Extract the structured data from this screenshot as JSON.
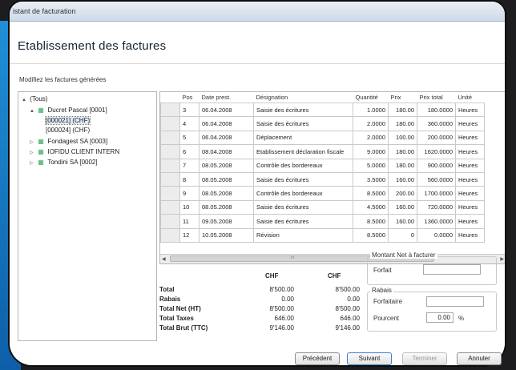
{
  "window": {
    "title": "istant de facturation"
  },
  "page": {
    "title": "Etablissement des factures",
    "subtitle": "Modifiez les factures générées"
  },
  "tree": [
    {
      "label": "(Tous)",
      "expander": "▲",
      "icon": ""
    },
    {
      "label": "Ducret Pascal [0001]",
      "expander": "▲",
      "icon": "building-icon"
    },
    {
      "label": "[000021] (CHF)",
      "expander": "",
      "icon": "",
      "selected": true
    },
    {
      "label": "[000024] (CHF)",
      "expander": "",
      "icon": ""
    },
    {
      "label": "Fondagest SA [0003]",
      "expander": "▷",
      "icon": "building-icon"
    },
    {
      "label": "IOFIDU CLIENT INTERN",
      "expander": "▷",
      "icon": "building-icon"
    },
    {
      "label": "Tondini SA [0002]",
      "expander": "▷",
      "icon": "building-icon"
    }
  ],
  "grid": {
    "columns": [
      "Pos",
      "Date prest.",
      "Désignation",
      "Quantité",
      "Prix",
      "Prix total",
      "Unité"
    ],
    "rows": [
      [
        "3",
        "06.04.2008",
        "Saisie des écritures",
        "1.0000",
        "180.00",
        "180.0000",
        "Heures"
      ],
      [
        "4",
        "06.04.2008",
        "Saisie des écritures",
        "2.0000",
        "180.00",
        "360.0000",
        "Heures"
      ],
      [
        "5",
        "06.04.2008",
        "Déplacement",
        "2.0000",
        "100.00",
        "200.0000",
        "Heures"
      ],
      [
        "6",
        "08.04.2008",
        "Etablissement déclaration fiscale",
        "9.0000",
        "180.00",
        "1620.0000",
        "Heures"
      ],
      [
        "7",
        "08.05.2008",
        "Contrôle des bordereaux",
        "5.0000",
        "180.00",
        "900.0000",
        "Heures"
      ],
      [
        "8",
        "08.05.2008",
        "Saisie des écritures",
        "3.5000",
        "160.00",
        "560.0000",
        "Heures"
      ],
      [
        "9",
        "08.05.2008",
        "Contrôle des bordereaux",
        "8.5000",
        "200.00",
        "1700.0000",
        "Heures"
      ],
      [
        "10",
        "08.05.2008",
        "Saisie des écritures",
        "4.5000",
        "160.00",
        "720.0000",
        "Heures"
      ],
      [
        "11",
        "09.05.2008",
        "Saisie des écritures",
        "8.5000",
        "160.00",
        "1360.0000",
        "Heures"
      ],
      [
        "12",
        "10.05.2008",
        "Révision",
        "8.5000",
        "0",
        "0.0000",
        "Heures"
      ]
    ],
    "hscroll_marker": "III"
  },
  "totals": {
    "currency1": "CHF",
    "currency2": "CHF",
    "rows": [
      {
        "label": "Total",
        "v1": "8'500.00",
        "v2": "8'500.00"
      },
      {
        "label": "Rabais",
        "v1": "0.00",
        "v2": "0.00"
      },
      {
        "label": "Total Net (HT)",
        "v1": "8'500.00",
        "v2": "8'500.00"
      },
      {
        "label": "Total Taxes",
        "v1": "646.00",
        "v2": "646.00"
      },
      {
        "label": "Total Brut (TTC)",
        "v1": "9'146.00",
        "v2": "9'146.00"
      }
    ]
  },
  "montant": {
    "group_title": "Montant Net à facturer",
    "forfait_label": "Forfait",
    "forfait_value": ""
  },
  "rabais": {
    "group_title": "Rabais",
    "forfaitaire_label": "Forfaitaire",
    "forfaitaire_value": "",
    "pourcent_label": "Pourcent",
    "pourcent_value": "0.00",
    "pourcent_unit": "%"
  },
  "buttons": {
    "precedent": "Précédent",
    "suivant": "Suivant",
    "terminer": "Terminer",
    "annuler": "Annuler"
  }
}
